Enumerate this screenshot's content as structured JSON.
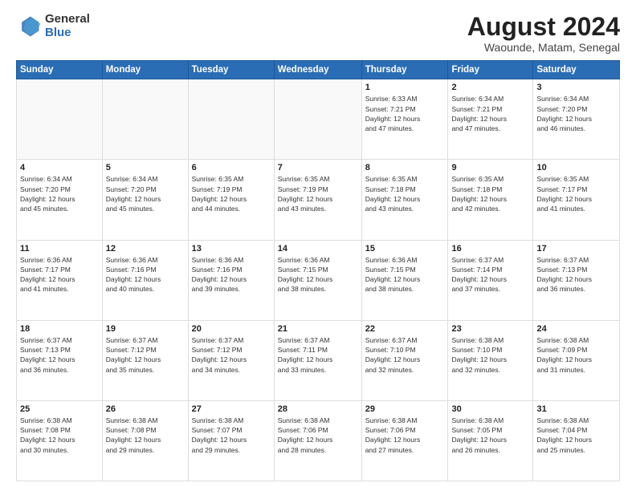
{
  "header": {
    "logo_general": "General",
    "logo_blue": "Blue",
    "month_year": "August 2024",
    "location": "Waounde, Matam, Senegal"
  },
  "days_of_week": [
    "Sunday",
    "Monday",
    "Tuesday",
    "Wednesday",
    "Thursday",
    "Friday",
    "Saturday"
  ],
  "weeks": [
    [
      {
        "day": "",
        "info": ""
      },
      {
        "day": "",
        "info": ""
      },
      {
        "day": "",
        "info": ""
      },
      {
        "day": "",
        "info": ""
      },
      {
        "day": "1",
        "info": "Sunrise: 6:33 AM\nSunset: 7:21 PM\nDaylight: 12 hours\nand 47 minutes."
      },
      {
        "day": "2",
        "info": "Sunrise: 6:34 AM\nSunset: 7:21 PM\nDaylight: 12 hours\nand 47 minutes."
      },
      {
        "day": "3",
        "info": "Sunrise: 6:34 AM\nSunset: 7:20 PM\nDaylight: 12 hours\nand 46 minutes."
      }
    ],
    [
      {
        "day": "4",
        "info": "Sunrise: 6:34 AM\nSunset: 7:20 PM\nDaylight: 12 hours\nand 45 minutes."
      },
      {
        "day": "5",
        "info": "Sunrise: 6:34 AM\nSunset: 7:20 PM\nDaylight: 12 hours\nand 45 minutes."
      },
      {
        "day": "6",
        "info": "Sunrise: 6:35 AM\nSunset: 7:19 PM\nDaylight: 12 hours\nand 44 minutes."
      },
      {
        "day": "7",
        "info": "Sunrise: 6:35 AM\nSunset: 7:19 PM\nDaylight: 12 hours\nand 43 minutes."
      },
      {
        "day": "8",
        "info": "Sunrise: 6:35 AM\nSunset: 7:18 PM\nDaylight: 12 hours\nand 43 minutes."
      },
      {
        "day": "9",
        "info": "Sunrise: 6:35 AM\nSunset: 7:18 PM\nDaylight: 12 hours\nand 42 minutes."
      },
      {
        "day": "10",
        "info": "Sunrise: 6:35 AM\nSunset: 7:17 PM\nDaylight: 12 hours\nand 41 minutes."
      }
    ],
    [
      {
        "day": "11",
        "info": "Sunrise: 6:36 AM\nSunset: 7:17 PM\nDaylight: 12 hours\nand 41 minutes."
      },
      {
        "day": "12",
        "info": "Sunrise: 6:36 AM\nSunset: 7:16 PM\nDaylight: 12 hours\nand 40 minutes."
      },
      {
        "day": "13",
        "info": "Sunrise: 6:36 AM\nSunset: 7:16 PM\nDaylight: 12 hours\nand 39 minutes."
      },
      {
        "day": "14",
        "info": "Sunrise: 6:36 AM\nSunset: 7:15 PM\nDaylight: 12 hours\nand 38 minutes."
      },
      {
        "day": "15",
        "info": "Sunrise: 6:36 AM\nSunset: 7:15 PM\nDaylight: 12 hours\nand 38 minutes."
      },
      {
        "day": "16",
        "info": "Sunrise: 6:37 AM\nSunset: 7:14 PM\nDaylight: 12 hours\nand 37 minutes."
      },
      {
        "day": "17",
        "info": "Sunrise: 6:37 AM\nSunset: 7:13 PM\nDaylight: 12 hours\nand 36 minutes."
      }
    ],
    [
      {
        "day": "18",
        "info": "Sunrise: 6:37 AM\nSunset: 7:13 PM\nDaylight: 12 hours\nand 36 minutes."
      },
      {
        "day": "19",
        "info": "Sunrise: 6:37 AM\nSunset: 7:12 PM\nDaylight: 12 hours\nand 35 minutes."
      },
      {
        "day": "20",
        "info": "Sunrise: 6:37 AM\nSunset: 7:12 PM\nDaylight: 12 hours\nand 34 minutes."
      },
      {
        "day": "21",
        "info": "Sunrise: 6:37 AM\nSunset: 7:11 PM\nDaylight: 12 hours\nand 33 minutes."
      },
      {
        "day": "22",
        "info": "Sunrise: 6:37 AM\nSunset: 7:10 PM\nDaylight: 12 hours\nand 32 minutes."
      },
      {
        "day": "23",
        "info": "Sunrise: 6:38 AM\nSunset: 7:10 PM\nDaylight: 12 hours\nand 32 minutes."
      },
      {
        "day": "24",
        "info": "Sunrise: 6:38 AM\nSunset: 7:09 PM\nDaylight: 12 hours\nand 31 minutes."
      }
    ],
    [
      {
        "day": "25",
        "info": "Sunrise: 6:38 AM\nSunset: 7:08 PM\nDaylight: 12 hours\nand 30 minutes."
      },
      {
        "day": "26",
        "info": "Sunrise: 6:38 AM\nSunset: 7:08 PM\nDaylight: 12 hours\nand 29 minutes."
      },
      {
        "day": "27",
        "info": "Sunrise: 6:38 AM\nSunset: 7:07 PM\nDaylight: 12 hours\nand 29 minutes."
      },
      {
        "day": "28",
        "info": "Sunrise: 6:38 AM\nSunset: 7:06 PM\nDaylight: 12 hours\nand 28 minutes."
      },
      {
        "day": "29",
        "info": "Sunrise: 6:38 AM\nSunset: 7:06 PM\nDaylight: 12 hours\nand 27 minutes."
      },
      {
        "day": "30",
        "info": "Sunrise: 6:38 AM\nSunset: 7:05 PM\nDaylight: 12 hours\nand 26 minutes."
      },
      {
        "day": "31",
        "info": "Sunrise: 6:38 AM\nSunset: 7:04 PM\nDaylight: 12 hours\nand 25 minutes."
      }
    ]
  ]
}
